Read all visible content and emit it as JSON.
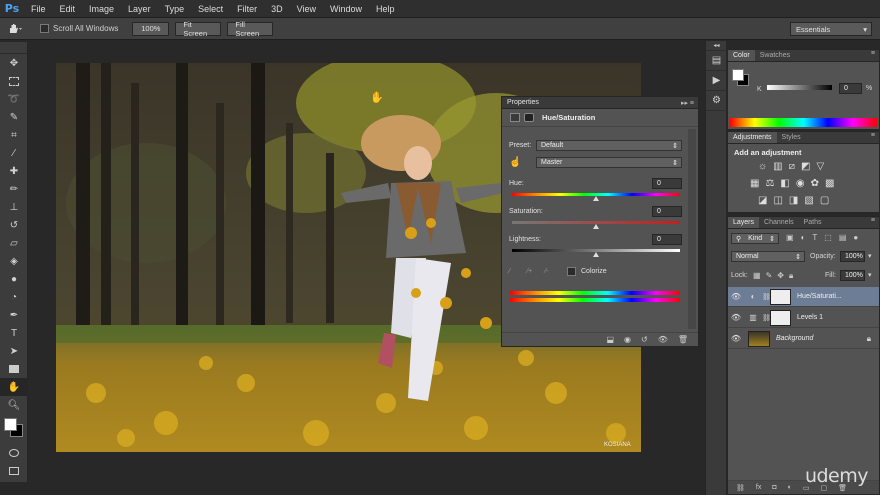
{
  "app": {
    "logo": "Ps"
  },
  "menu": [
    "File",
    "Edit",
    "Image",
    "Layer",
    "Type",
    "Select",
    "Filter",
    "3D",
    "View",
    "Window",
    "Help"
  ],
  "options": {
    "scroll_all": "Scroll All Windows",
    "btn_100": "100%",
    "btn_fit": "Fit Screen",
    "btn_fill": "Fill Screen",
    "workspace": "Essentials"
  },
  "properties": {
    "tab": "Properties",
    "title": "Hue/Saturation",
    "preset_label": "Preset:",
    "preset_value": "Default",
    "channel": "Master",
    "hue_label": "Hue:",
    "hue_value": "0",
    "sat_label": "Saturation:",
    "sat_value": "0",
    "light_label": "Lightness:",
    "light_value": "0",
    "colorize": "Colorize"
  },
  "color_panel": {
    "tab_color": "Color",
    "tab_swatches": "Swatches",
    "k_label": "K",
    "k_value": "0",
    "pct": "%"
  },
  "adjustments": {
    "tab": "Adjustments",
    "tab_styles": "Styles",
    "heading": "Add an adjustment"
  },
  "layers": {
    "tab_layers": "Layers",
    "tab_channels": "Channels",
    "tab_paths": "Paths",
    "kind": "Kind",
    "blend": "Normal",
    "opacity_label": "Opacity:",
    "opacity_value": "100%",
    "lock_label": "Lock:",
    "fill_label": "Fill:",
    "fill_value": "100%",
    "items": [
      {
        "name": "Hue/Saturati..."
      },
      {
        "name": "Levels 1"
      },
      {
        "name": "Background"
      }
    ]
  },
  "watermark": "udemy",
  "photo_credit": "KOSIANA"
}
